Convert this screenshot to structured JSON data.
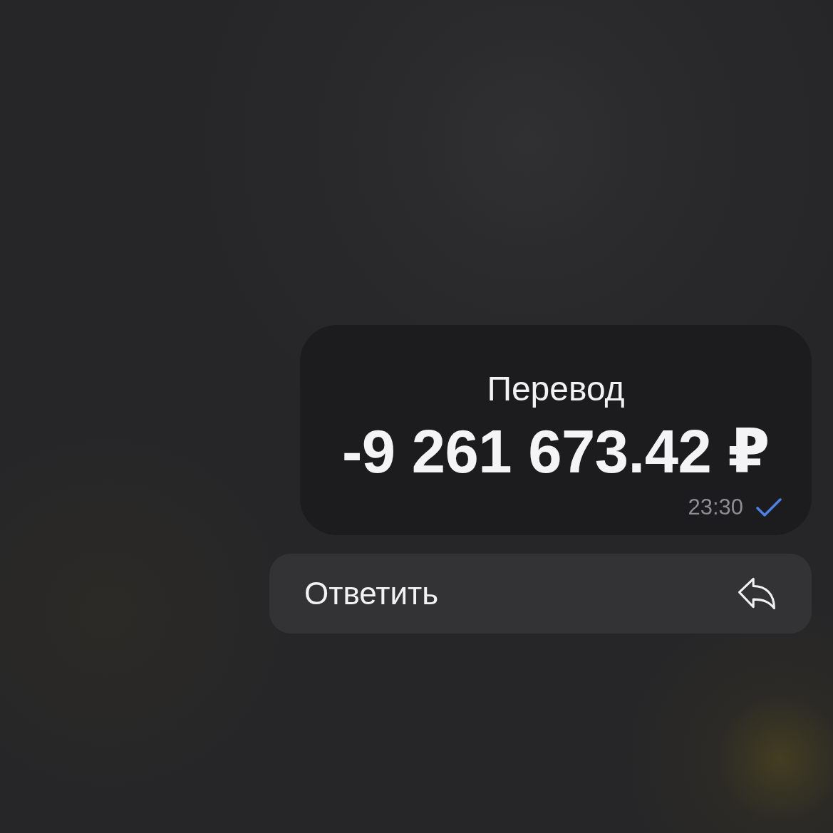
{
  "message": {
    "title": "Перевод",
    "amount": "-9 261 673.42 ₽",
    "time": "23:30",
    "read": false
  },
  "actions": [
    {
      "label": "Ответить"
    }
  ]
}
